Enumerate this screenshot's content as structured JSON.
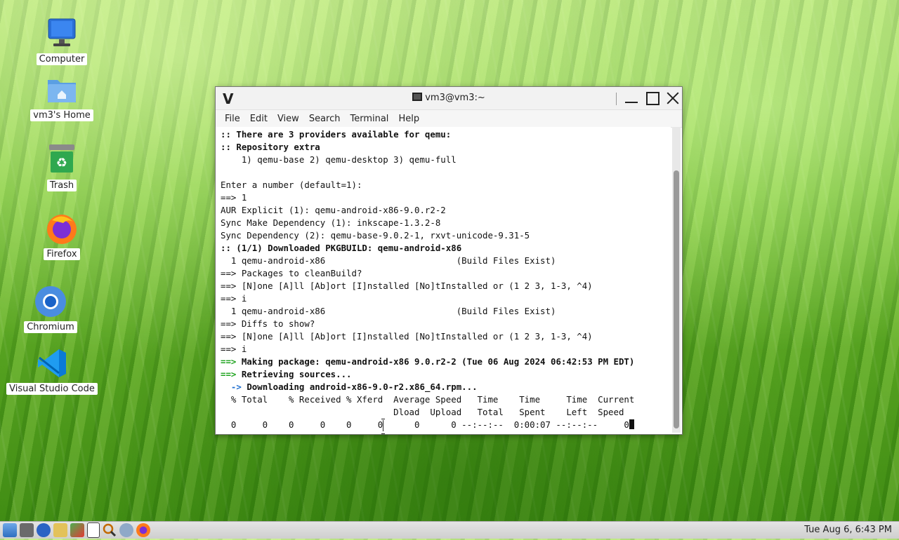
{
  "desktop": {
    "icons": [
      {
        "label": "Computer",
        "icon": "computer-icon"
      },
      {
        "label": "vm3's Home",
        "icon": "home-folder-icon"
      },
      {
        "label": "Trash",
        "icon": "trash-icon"
      },
      {
        "label": "Firefox",
        "icon": "firefox-icon"
      },
      {
        "label": "Chromium",
        "icon": "chromium-icon"
      },
      {
        "label": "Visual Studio Code",
        "icon": "vscode-icon"
      }
    ]
  },
  "terminal": {
    "title": "vm3@vm3:~",
    "logo": "V",
    "menu": [
      "File",
      "Edit",
      "View",
      "Search",
      "Terminal",
      "Help"
    ],
    "lines": [
      ":: There are 3 providers available for qemu:",
      ":: Repository extra",
      "    1) qemu-base 2) qemu-desktop 3) qemu-full",
      "",
      "Enter a number (default=1):",
      "==> 1",
      "AUR Explicit (1): qemu-android-x86-9.0.r2-2",
      "Sync Make Dependency (1): inkscape-1.3.2-8",
      "Sync Dependency (2): qemu-base-9.0.2-1, rxvt-unicode-9.31-5",
      ":: (1/1) Downloaded PKGBUILD: qemu-android-x86",
      "  1 qemu-android-x86                         (Build Files Exist)",
      "==> Packages to cleanBuild?",
      "==> [N]one [A]ll [Ab]ort [I]nstalled [No]tInstalled or (1 2 3, 1-3, ^4)",
      "==> i",
      "  1 qemu-android-x86                         (Build Files Exist)",
      "==> Diffs to show?",
      "==> [N]one [A]ll [Ab]ort [I]nstalled [No]tInstalled or (1 2 3, 1-3, ^4)",
      "==> i",
      "Making package: qemu-android-x86 9.0.r2-2 (Tue 06 Aug 2024 06:42:53 PM EDT)",
      "Retrieving sources...",
      "  -> Downloading android-x86-9.0-r2.x86_64.rpm...",
      "  % Total    % Received % Xferd  Average Speed   Time    Time     Time  Current",
      "                                 Dload  Upload   Total   Spent    Left  Speed",
      "  0     0    0     0    0     0      0      0 --:--:--  0:00:07 --:--:--     0"
    ],
    "green_arrow": "==>",
    "making_text": " Making package: qemu-android-x86 9.0.r2-2 (Tue 06 Aug 2024 06:42:53 PM EDT)",
    "retrieving_text": " Retrieving sources...",
    "downloading_text": "Downloading android-x86-9.0-r2.x86_64.rpm...",
    "sub_arrow": "  ->"
  },
  "taskbar": {
    "icons": [
      "start-menu-icon",
      "settings-icon",
      "accessibility-icon",
      "tasks-icon",
      "paint-icon",
      "terminal-icon",
      "search-magnifier-icon",
      "network-icon",
      "firefox-icon"
    ],
    "clock": "Tue Aug  6,  6:43 PM"
  }
}
